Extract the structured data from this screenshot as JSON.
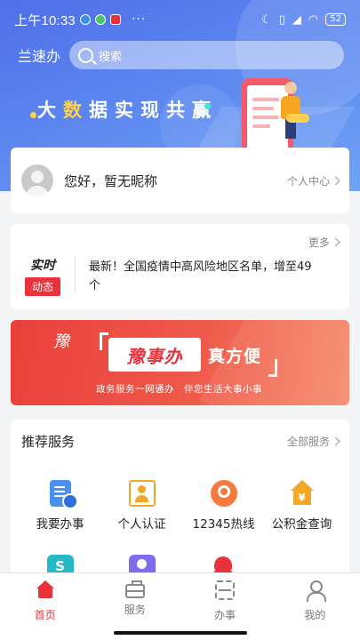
{
  "status_bar": {
    "time": "上午10:33",
    "dots": "···",
    "battery": "52"
  },
  "header": {
    "app_title": "兰速办",
    "search_placeholder": "搜索"
  },
  "hero": {
    "slogan_chars": [
      "大",
      "数",
      "据",
      "实",
      "现",
      "共",
      "赢"
    ]
  },
  "user_card": {
    "greeting": "您好，暂无昵称",
    "personal_center": "个人中心"
  },
  "news": {
    "more": "更多",
    "tag_line1": "实时",
    "tag_line2": "动态",
    "headline": "最新！全国疫情中高风险地区名单，增至49个"
  },
  "banner": {
    "main_left": "豫事办",
    "main_right": "真方便",
    "subtitle": "政务服务一网通办　伴您生活大事小事",
    "logo_text": "豫"
  },
  "services": {
    "title": "推荐服务",
    "all": "全部服务",
    "items": [
      {
        "label": "我要办事",
        "icon": "document-icon"
      },
      {
        "label": "个人认证",
        "icon": "id-verify-icon"
      },
      {
        "label": "12345热线",
        "icon": "hotline-icon"
      },
      {
        "label": "公积金查询",
        "icon": "housing-fund-icon"
      },
      {
        "label": "",
        "icon": "social-security-icon"
      },
      {
        "label": "",
        "icon": "person-badge-icon"
      },
      {
        "label": "",
        "icon": "medical-icon"
      }
    ]
  },
  "tabbar": [
    {
      "label": "首页",
      "icon": "home-icon",
      "active": true
    },
    {
      "label": "服务",
      "icon": "briefcase-icon",
      "active": false
    },
    {
      "label": "办事",
      "icon": "scan-icon",
      "active": false
    },
    {
      "label": "我的",
      "icon": "profile-icon",
      "active": false
    }
  ],
  "colors": {
    "brand_blue": "#4f6fe8",
    "accent_red": "#e8333c",
    "highlight_yellow": "#ffd04a"
  }
}
